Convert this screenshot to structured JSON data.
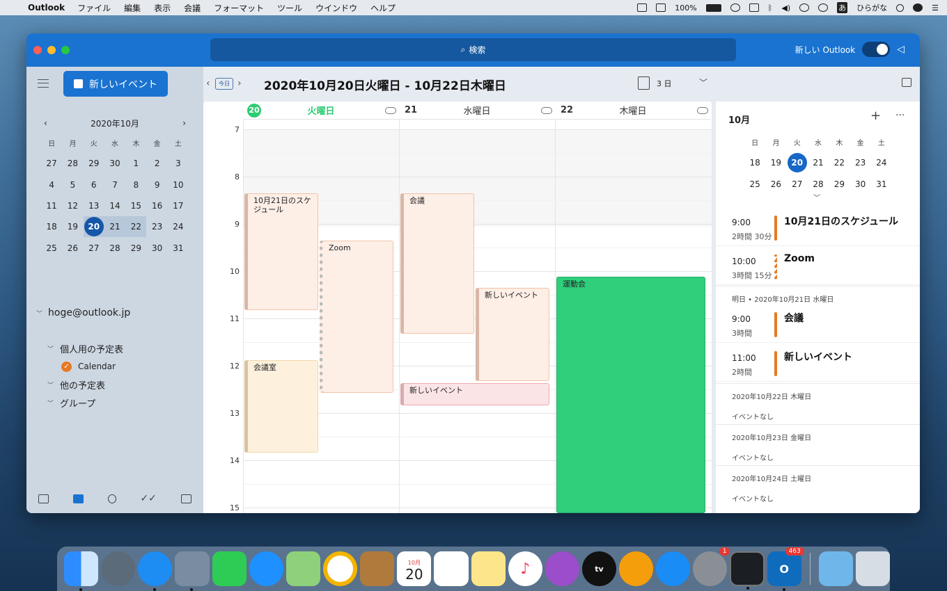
{
  "menubar": {
    "app": "Outlook",
    "items": [
      "ファイル",
      "編集",
      "表示",
      "会議",
      "フォーマット",
      "ツール",
      "ウインドウ",
      "ヘルプ"
    ],
    "battery": "100%",
    "input_mode": "ひらがな",
    "input_badge": "あ"
  },
  "titlebar": {
    "search_label": "検索",
    "new_outlook_label": "新しい Outlook"
  },
  "sidebar": {
    "new_event_label": "新しいイベント",
    "account": "hoge@outlook.jp",
    "groups": [
      {
        "label": "個人用の予定表"
      },
      {
        "label": "Calendar"
      },
      {
        "label": "他の予定表"
      },
      {
        "label": "グループ"
      }
    ]
  },
  "minical": {
    "month_label": "2020年10月",
    "weekdays": [
      "日",
      "月",
      "火",
      "水",
      "木",
      "金",
      "土"
    ],
    "weeks": [
      [
        "27",
        "28",
        "29",
        "30",
        "1",
        "2",
        "3"
      ],
      [
        "4",
        "5",
        "6",
        "7",
        "8",
        "9",
        "10"
      ],
      [
        "11",
        "12",
        "13",
        "14",
        "15",
        "16",
        "17"
      ],
      [
        "18",
        "19",
        "20",
        "21",
        "22",
        "23",
        "24"
      ],
      [
        "25",
        "26",
        "27",
        "28",
        "29",
        "30",
        "31"
      ]
    ]
  },
  "toolbar": {
    "today_label": "今日",
    "date_range": "2020年10月20日火曜日 - 10月22日木曜日",
    "view_label": "3 日"
  },
  "days": [
    {
      "num": "20",
      "name": "火曜日"
    },
    {
      "num": "21",
      "name": "水曜日"
    },
    {
      "num": "22",
      "name": "木曜日"
    }
  ],
  "hours": [
    "7",
    "8",
    "9",
    "10",
    "11",
    "12",
    "13",
    "14",
    "15"
  ],
  "events": [
    {
      "title": "10月21日のスケジュール",
      "style": "ev-or",
      "day": 0
    },
    {
      "title": "Zoom",
      "style": "ev-dot",
      "day": 0
    },
    {
      "title": "会議室",
      "style": "ev-yel",
      "day": 0
    },
    {
      "title": "会議",
      "style": "ev-or",
      "day": 1
    },
    {
      "title": "新しいイベント",
      "style": "ev-or",
      "day": 1
    },
    {
      "title": "新しいイベント",
      "style": "ev-pink",
      "day": 1
    },
    {
      "title": "運動会",
      "style": "ev-green",
      "day": 2
    }
  ],
  "agenda": {
    "month": "10月",
    "weekdays": [
      "日",
      "月",
      "火",
      "水",
      "木",
      "金",
      "土"
    ],
    "weeks": [
      [
        "18",
        "19",
        "20",
        "21",
        "22",
        "23",
        "24"
      ],
      [
        "25",
        "26",
        "27",
        "28",
        "29",
        "30",
        "31"
      ]
    ],
    "items": [
      {
        "time": "9:00",
        "dur": "2時間 30分",
        "title": "10月21日のスケジュール",
        "dotted": false
      },
      {
        "time": "10:00",
        "dur": "3時間 15分",
        "title": "Zoom",
        "dotted": true
      }
    ],
    "tomorrow_label": "明日 • 2020年10月21日 水曜日",
    "tomorrow_items": [
      {
        "time": "9:00",
        "dur": "3時間",
        "title": "会議"
      },
      {
        "time": "11:00",
        "dur": "2時間",
        "title": "新しいイベント"
      }
    ],
    "later": [
      {
        "date": "2020年10月22日 木曜日",
        "none": "イベントなし"
      },
      {
        "date": "2020年10月23日 金曜日",
        "none": "イベントなし"
      },
      {
        "date": "2020年10月24日 土曜日",
        "none": "イベントなし"
      }
    ]
  },
  "dock": {
    "calendar_month": "10月",
    "calendar_day": "20",
    "tv_label": "tv",
    "settings_badge": "1",
    "outlook_badge": "463"
  }
}
